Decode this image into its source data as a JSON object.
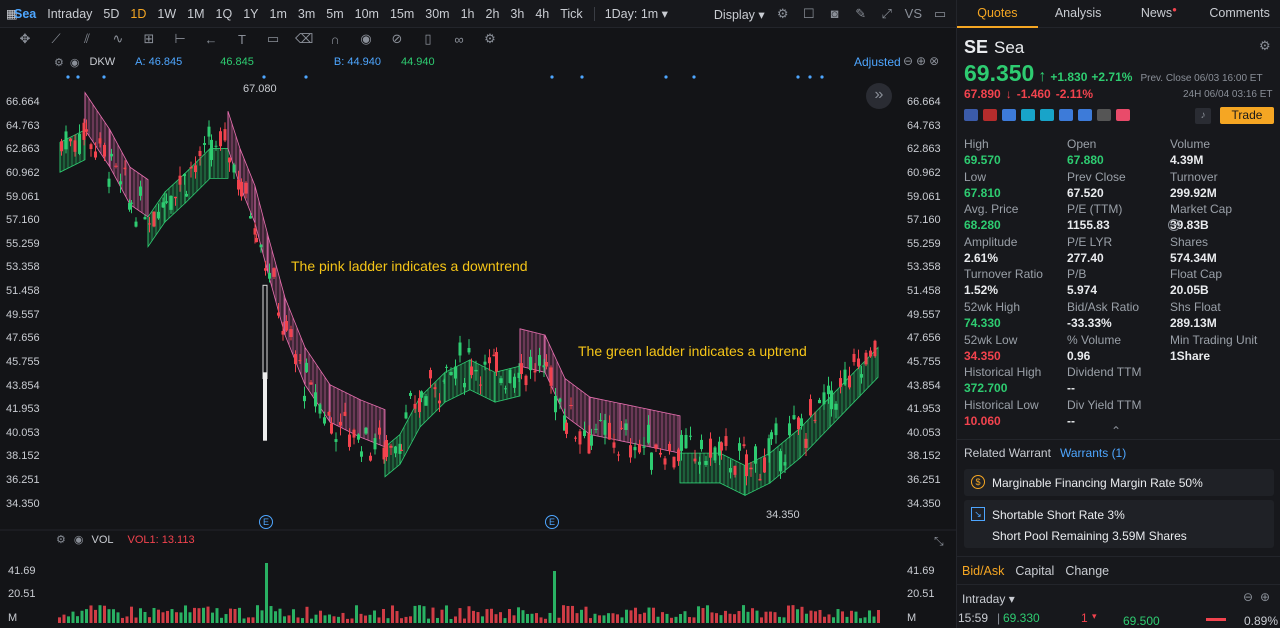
{
  "topbar": {
    "symbol": "Sea",
    "tabs": [
      "Intraday",
      "5D",
      "1D",
      "1W",
      "1M",
      "1Q",
      "1Y",
      "1m",
      "3m",
      "5m",
      "10m",
      "15m",
      "30m",
      "1h",
      "2h",
      "3h",
      "4h",
      "Tick"
    ],
    "active_tab": "1D",
    "interval": "1Day: 1m",
    "display": "Display",
    "vs": "VS"
  },
  "indicator_bar": {
    "name": "DKW",
    "a_label": "A: 46.845",
    "a_value": "46.845",
    "b_label": "B: 44.940",
    "b_value": "44.940",
    "adjusted": "Adjusted"
  },
  "price_axis": [
    "66.664",
    "64.763",
    "62.863",
    "60.962",
    "59.061",
    "57.160",
    "55.259",
    "53.358",
    "51.458",
    "49.557",
    "47.656",
    "45.755",
    "43.854",
    "41.953",
    "40.053",
    "38.152",
    "36.251",
    "34.350"
  ],
  "markers": {
    "high": "67.080",
    "low": "34.350",
    "earnings": "E"
  },
  "annotations": {
    "down": "The pink ladder indicates a downtrend",
    "up": "The green ladder indicates a uptrend"
  },
  "volume": {
    "name": "VOL",
    "vol1": "VOL1: 13.113",
    "axis": [
      "41.69",
      "20.51",
      "M"
    ]
  },
  "colors": {
    "up": "#2ecc71",
    "down": "#f2434e",
    "accent": "#f5a623",
    "blue": "#4ea6ff",
    "pink": "#e86fb0"
  },
  "quote": {
    "tabs": [
      "Quotes",
      "Analysis",
      "News",
      "Comments"
    ],
    "ticker": "SE",
    "name": "Sea",
    "price": "69.350",
    "arrow": "↑",
    "change": "+1.830",
    "change_pct": "+2.71%",
    "prev_close_label": "Prev. Close 06/03 16:00 ET",
    "ext_price": "67.890",
    "ext_arrow": "↓",
    "ext_change": "-1.460",
    "ext_change_pct": "-2.11%",
    "ext_time": "24H 06/04 03:16 ET",
    "trade": "Trade",
    "stats": [
      {
        "k": "High",
        "v": "69.570",
        "c": "green"
      },
      {
        "k": "Open",
        "v": "67.880",
        "c": "green"
      },
      {
        "k": "Volume",
        "v": "4.39M",
        "c": ""
      },
      {
        "k": "Low",
        "v": "67.810",
        "c": "green"
      },
      {
        "k": "Prev Close",
        "v": "67.520",
        "c": ""
      },
      {
        "k": "Turnover",
        "v": "299.92M",
        "c": ""
      },
      {
        "k": "Avg. Price",
        "v": "68.280",
        "c": "green"
      },
      {
        "k": "P/E (TTM)",
        "v": "1155.83",
        "c": ""
      },
      {
        "k": "Market Cap",
        "v": "39.83B",
        "c": ""
      },
      {
        "k": "Amplitude",
        "v": "2.61%",
        "c": ""
      },
      {
        "k": "P/E LYR",
        "v": "277.40",
        "c": ""
      },
      {
        "k": "Shares",
        "v": "574.34M",
        "c": ""
      },
      {
        "k": "Turnover Ratio",
        "v": "1.52%",
        "c": ""
      },
      {
        "k": "P/B",
        "v": "5.974",
        "c": ""
      },
      {
        "k": "Float Cap",
        "v": "20.05B",
        "c": ""
      },
      {
        "k": "52wk High",
        "v": "74.330",
        "c": "green"
      },
      {
        "k": "Bid/Ask Ratio",
        "v": "-33.33%",
        "c": ""
      },
      {
        "k": "Shs Float",
        "v": "289.13M",
        "c": ""
      },
      {
        "k": "52wk Low",
        "v": "34.350",
        "c": "red"
      },
      {
        "k": "% Volume",
        "v": "0.96",
        "c": ""
      },
      {
        "k": "Min Trading Unit",
        "v": "1Share",
        "c": ""
      },
      {
        "k": "Historical High",
        "v": "372.700",
        "c": "green"
      },
      {
        "k": "Dividend TTM",
        "v": "--",
        "c": ""
      },
      {
        "k": "",
        "v": "",
        "c": ""
      },
      {
        "k": "Historical Low",
        "v": "10.060",
        "c": "red"
      },
      {
        "k": "Div Yield TTM",
        "v": "--",
        "c": ""
      },
      {
        "k": "",
        "v": "",
        "c": ""
      }
    ],
    "related_warrant": "Related Warrant",
    "warrants": "Warrants (1)",
    "margin": "Marginable Financing Margin Rate 50%",
    "short_rate": "Shortable Short Rate 3%",
    "short_pool": "Short Pool Remaining 3.59M Shares",
    "bottom_tabs": [
      "Bid/Ask",
      "Capital",
      "Change"
    ],
    "intraday": "Intraday",
    "tick_time": "15:59",
    "tick_price": "69.330",
    "tick_qty": "1",
    "bid_price": "69.500",
    "bid_pct": "0.89%"
  }
}
